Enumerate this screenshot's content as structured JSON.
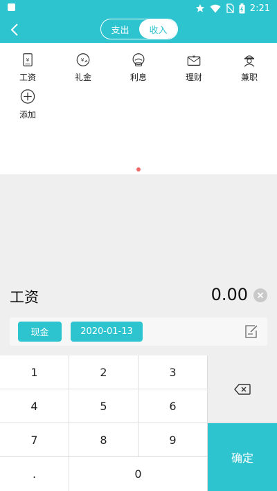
{
  "status_bar": {
    "time": "2:21",
    "icons": [
      "star-icon",
      "wifi-icon",
      "no-sim-icon",
      "battery-icon"
    ]
  },
  "header": {
    "tabs": [
      {
        "label": "支出",
        "active": false
      },
      {
        "label": "收入",
        "active": true
      }
    ]
  },
  "categories": [
    {
      "label": "工资",
      "icon": "salary-icon"
    },
    {
      "label": "礼金",
      "icon": "gift-money-icon"
    },
    {
      "label": "利息",
      "icon": "interest-icon"
    },
    {
      "label": "理财",
      "icon": "finance-icon"
    },
    {
      "label": "兼职",
      "icon": "part-time-icon"
    },
    {
      "label": "添加",
      "icon": "add-icon"
    }
  ],
  "entry": {
    "category": "工资",
    "amount": "0.00"
  },
  "options": {
    "account": "现金",
    "date": "2020-01-13"
  },
  "keypad": {
    "keys": [
      "1",
      "2",
      "3",
      "4",
      "5",
      "6",
      "7",
      "8",
      "9",
      ".",
      "0"
    ],
    "confirm": "确定"
  },
  "colors": {
    "accent": "#2ec4cf",
    "background_gray": "#efefef",
    "pager_dot": "#f06a6a"
  }
}
